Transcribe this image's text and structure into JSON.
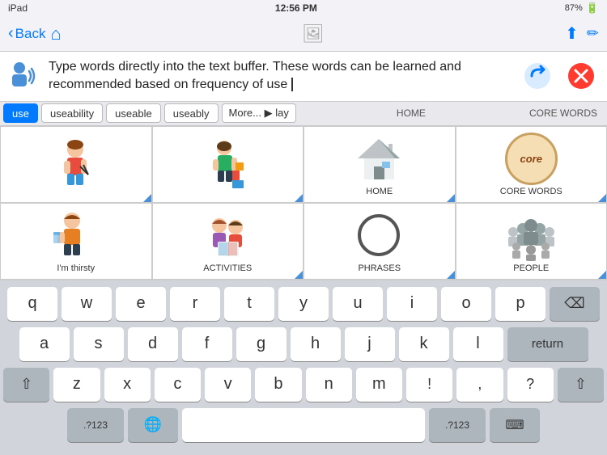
{
  "statusBar": {
    "device": "iPad",
    "time": "12:56 PM",
    "battery": "87%"
  },
  "navBar": {
    "backLabel": "Back",
    "centerIcon": "image-icon"
  },
  "textBuffer": {
    "text": "Type words directly into the text buffer. These words can be learned and recommended based on frequency of use",
    "speakerIcon": "speaker-icon",
    "undoIcon": "undo-icon",
    "closeIcon": "close-icon"
  },
  "autocomplete": {
    "items": [
      "use",
      "useability",
      "useable",
      "useably",
      "More..."
    ],
    "activeIndex": 0
  },
  "symbolGrid": {
    "rows": [
      [
        {
          "id": "cell-boy-scissors",
          "label": "",
          "type": "image"
        },
        {
          "id": "cell-boy-blocks",
          "label": "",
          "type": "image"
        },
        {
          "id": "cell-home",
          "label": "HOME",
          "type": "image"
        },
        {
          "id": "cell-core",
          "label": "CORE WORDS",
          "type": "core"
        }
      ],
      [
        {
          "id": "cell-thirsty",
          "label": "I'm thirsty",
          "type": "image"
        },
        {
          "id": "cell-activities",
          "label": "ACTIVITIES",
          "type": "image"
        },
        {
          "id": "cell-phrases",
          "label": "PHRASES",
          "type": "image"
        },
        {
          "id": "cell-people",
          "label": "PEOPLE",
          "type": "image"
        }
      ]
    ]
  },
  "keyboard": {
    "rows": [
      [
        "q",
        "w",
        "e",
        "r",
        "t",
        "y",
        "u",
        "i",
        "o",
        "p"
      ],
      [
        "a",
        "s",
        "d",
        "f",
        "g",
        "h",
        "j",
        "k",
        "l"
      ],
      [
        "z",
        "x",
        "c",
        "v",
        "b",
        "n",
        "m",
        "!",
        ",",
        "?"
      ]
    ],
    "specialKeys": {
      "shift": "⇧",
      "backspace": "⌫",
      "return": "return",
      "numbers": ".?123",
      "globe": "🌐",
      "space": " ",
      "hideKeyboard": "⌨"
    }
  }
}
